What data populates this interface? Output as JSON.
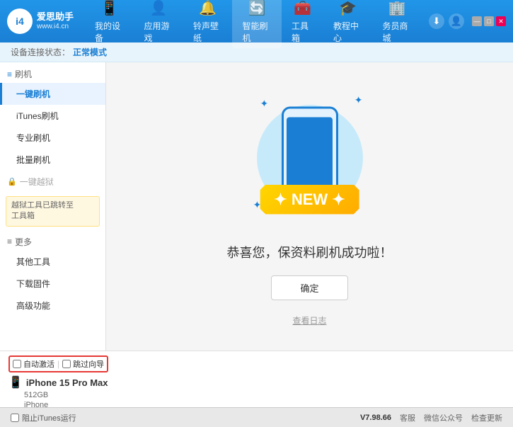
{
  "app": {
    "logo_text": "爱思助手",
    "logo_url": "www.i4.cn",
    "logo_char": "i4"
  },
  "nav": {
    "items": [
      {
        "id": "my-device",
        "icon": "📱",
        "label": "我的设备"
      },
      {
        "id": "apps-games",
        "icon": "👤",
        "label": "应用游戏"
      },
      {
        "id": "ringtone",
        "icon": "🔔",
        "label": "铃声壁纸"
      },
      {
        "id": "smart-flash",
        "icon": "🔄",
        "label": "智能刷机",
        "active": true
      },
      {
        "id": "toolbox",
        "icon": "🧰",
        "label": "工具箱"
      },
      {
        "id": "tutorial",
        "icon": "🎓",
        "label": "教程中心"
      },
      {
        "id": "service",
        "icon": "🏢",
        "label": "务员商城"
      }
    ]
  },
  "status_bar": {
    "prefix": "设备连接状态：",
    "value": "正常模式"
  },
  "sidebar": {
    "flash_section_label": "刷机",
    "items": [
      {
        "id": "one-click-flash",
        "label": "一键刷机",
        "active": true
      },
      {
        "id": "itunes-flash",
        "label": "iTunes刷机"
      },
      {
        "id": "pro-flash",
        "label": "专业刷机"
      },
      {
        "id": "batch-flash",
        "label": "批量刷机"
      }
    ],
    "disabled_label": "一键越狱",
    "notice_text": "越狱工具已跳转至\n工具箱",
    "more_section_label": "更多",
    "more_items": [
      {
        "id": "other-tools",
        "label": "其他工具"
      },
      {
        "id": "download-firmware",
        "label": "下载固件"
      },
      {
        "id": "advanced",
        "label": "高级功能"
      }
    ]
  },
  "content": {
    "new_banner_text": "NEW",
    "new_banner_stars": "✦",
    "success_title": "恭喜您，保资料刷机成功啦！",
    "confirm_btn": "确定",
    "log_btn": "查看日志"
  },
  "device": {
    "auto_activate_label": "自动激活",
    "time_guide_label": "跳过向导",
    "name": "iPhone 15 Pro Max",
    "storage": "512GB",
    "type": "iPhone"
  },
  "footer": {
    "itunes_label": "阻止iTunes运行",
    "version": "V7.98.66",
    "items": [
      "客服",
      "微信公众号",
      "检查更新"
    ]
  }
}
